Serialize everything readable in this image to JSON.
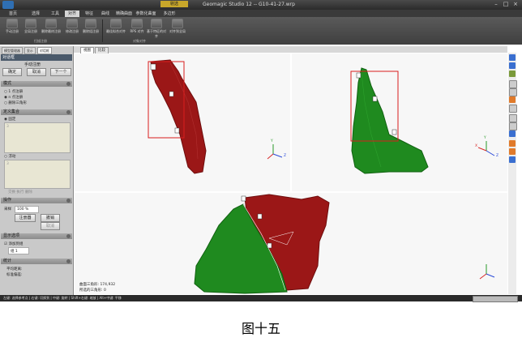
{
  "window": {
    "title": "Geomagic Studio 12 -- G10-41-27.wrp",
    "context_tab": "剔选"
  },
  "menu_tabs": [
    "首页",
    "选择",
    "工具",
    "对齐",
    "特征",
    "曲线",
    "精确曲面",
    "参数化曲面",
    "多边形"
  ],
  "ribbon": {
    "buttons": [
      "手动注册",
      "全局注册",
      "删除最终注册",
      "修改注册",
      "删除组注册",
      "最佳拟合对齐",
      "RPS 对齐",
      "基于特征的对齐",
      "对齐到全局"
    ],
    "groups": [
      "扫描注册",
      "对象对齐"
    ]
  },
  "panel": {
    "tabs": [
      "模型管理器",
      "显示",
      "对话框"
    ],
    "header": "对话框",
    "dialog_title": "手动注册",
    "buttons": {
      "ok": "确定",
      "cancel": "取消",
      "next": "下一个"
    },
    "mode": {
      "title": "模式",
      "options": [
        "1 点注册",
        "n 点注册",
        "删除三角形"
      ]
    },
    "define_set": {
      "title": "定义集合",
      "fixed_label": "固定",
      "fixed_items": [
        "3"
      ],
      "floating_label": "浮动",
      "floating_items": [
        "3"
      ],
      "swap_label": "交换  执行  删除"
    },
    "operation": {
      "title": "操作",
      "sample_label": "采样",
      "sample_value": "100 %",
      "register_btn": "注册器",
      "undo_btn": "撤销",
      "cancel_btn": "取消"
    },
    "display": {
      "title": "显示选项",
      "check_label": "添加到组",
      "group_value": "组 1"
    },
    "stats": {
      "title": "统计",
      "avg_distance": "平均距离:",
      "std_dev": "标准偏差:"
    }
  },
  "view_tabs": [
    "视图",
    "比较"
  ],
  "viewport": {
    "bottom_readout_1": "曲面三角形: 174,932",
    "bottom_readout_2": "所选的三角形: 0",
    "axes": {
      "x": "X",
      "y": "Y",
      "z": "Z"
    },
    "markers": [
      "1",
      "2",
      "3"
    ]
  },
  "status_bar": "左键: 选择参考点 | 右键: 切换到 | 中键: 旋转 | Shift+右键: 缩放 | Alt+中键: 平移",
  "caption": "图十五",
  "colors": {
    "red_mesh": "#a01818",
    "green_mesh": "#1f8a1f",
    "selection_box": "#d81e1e",
    "title_bar": "#2b2b2b"
  }
}
